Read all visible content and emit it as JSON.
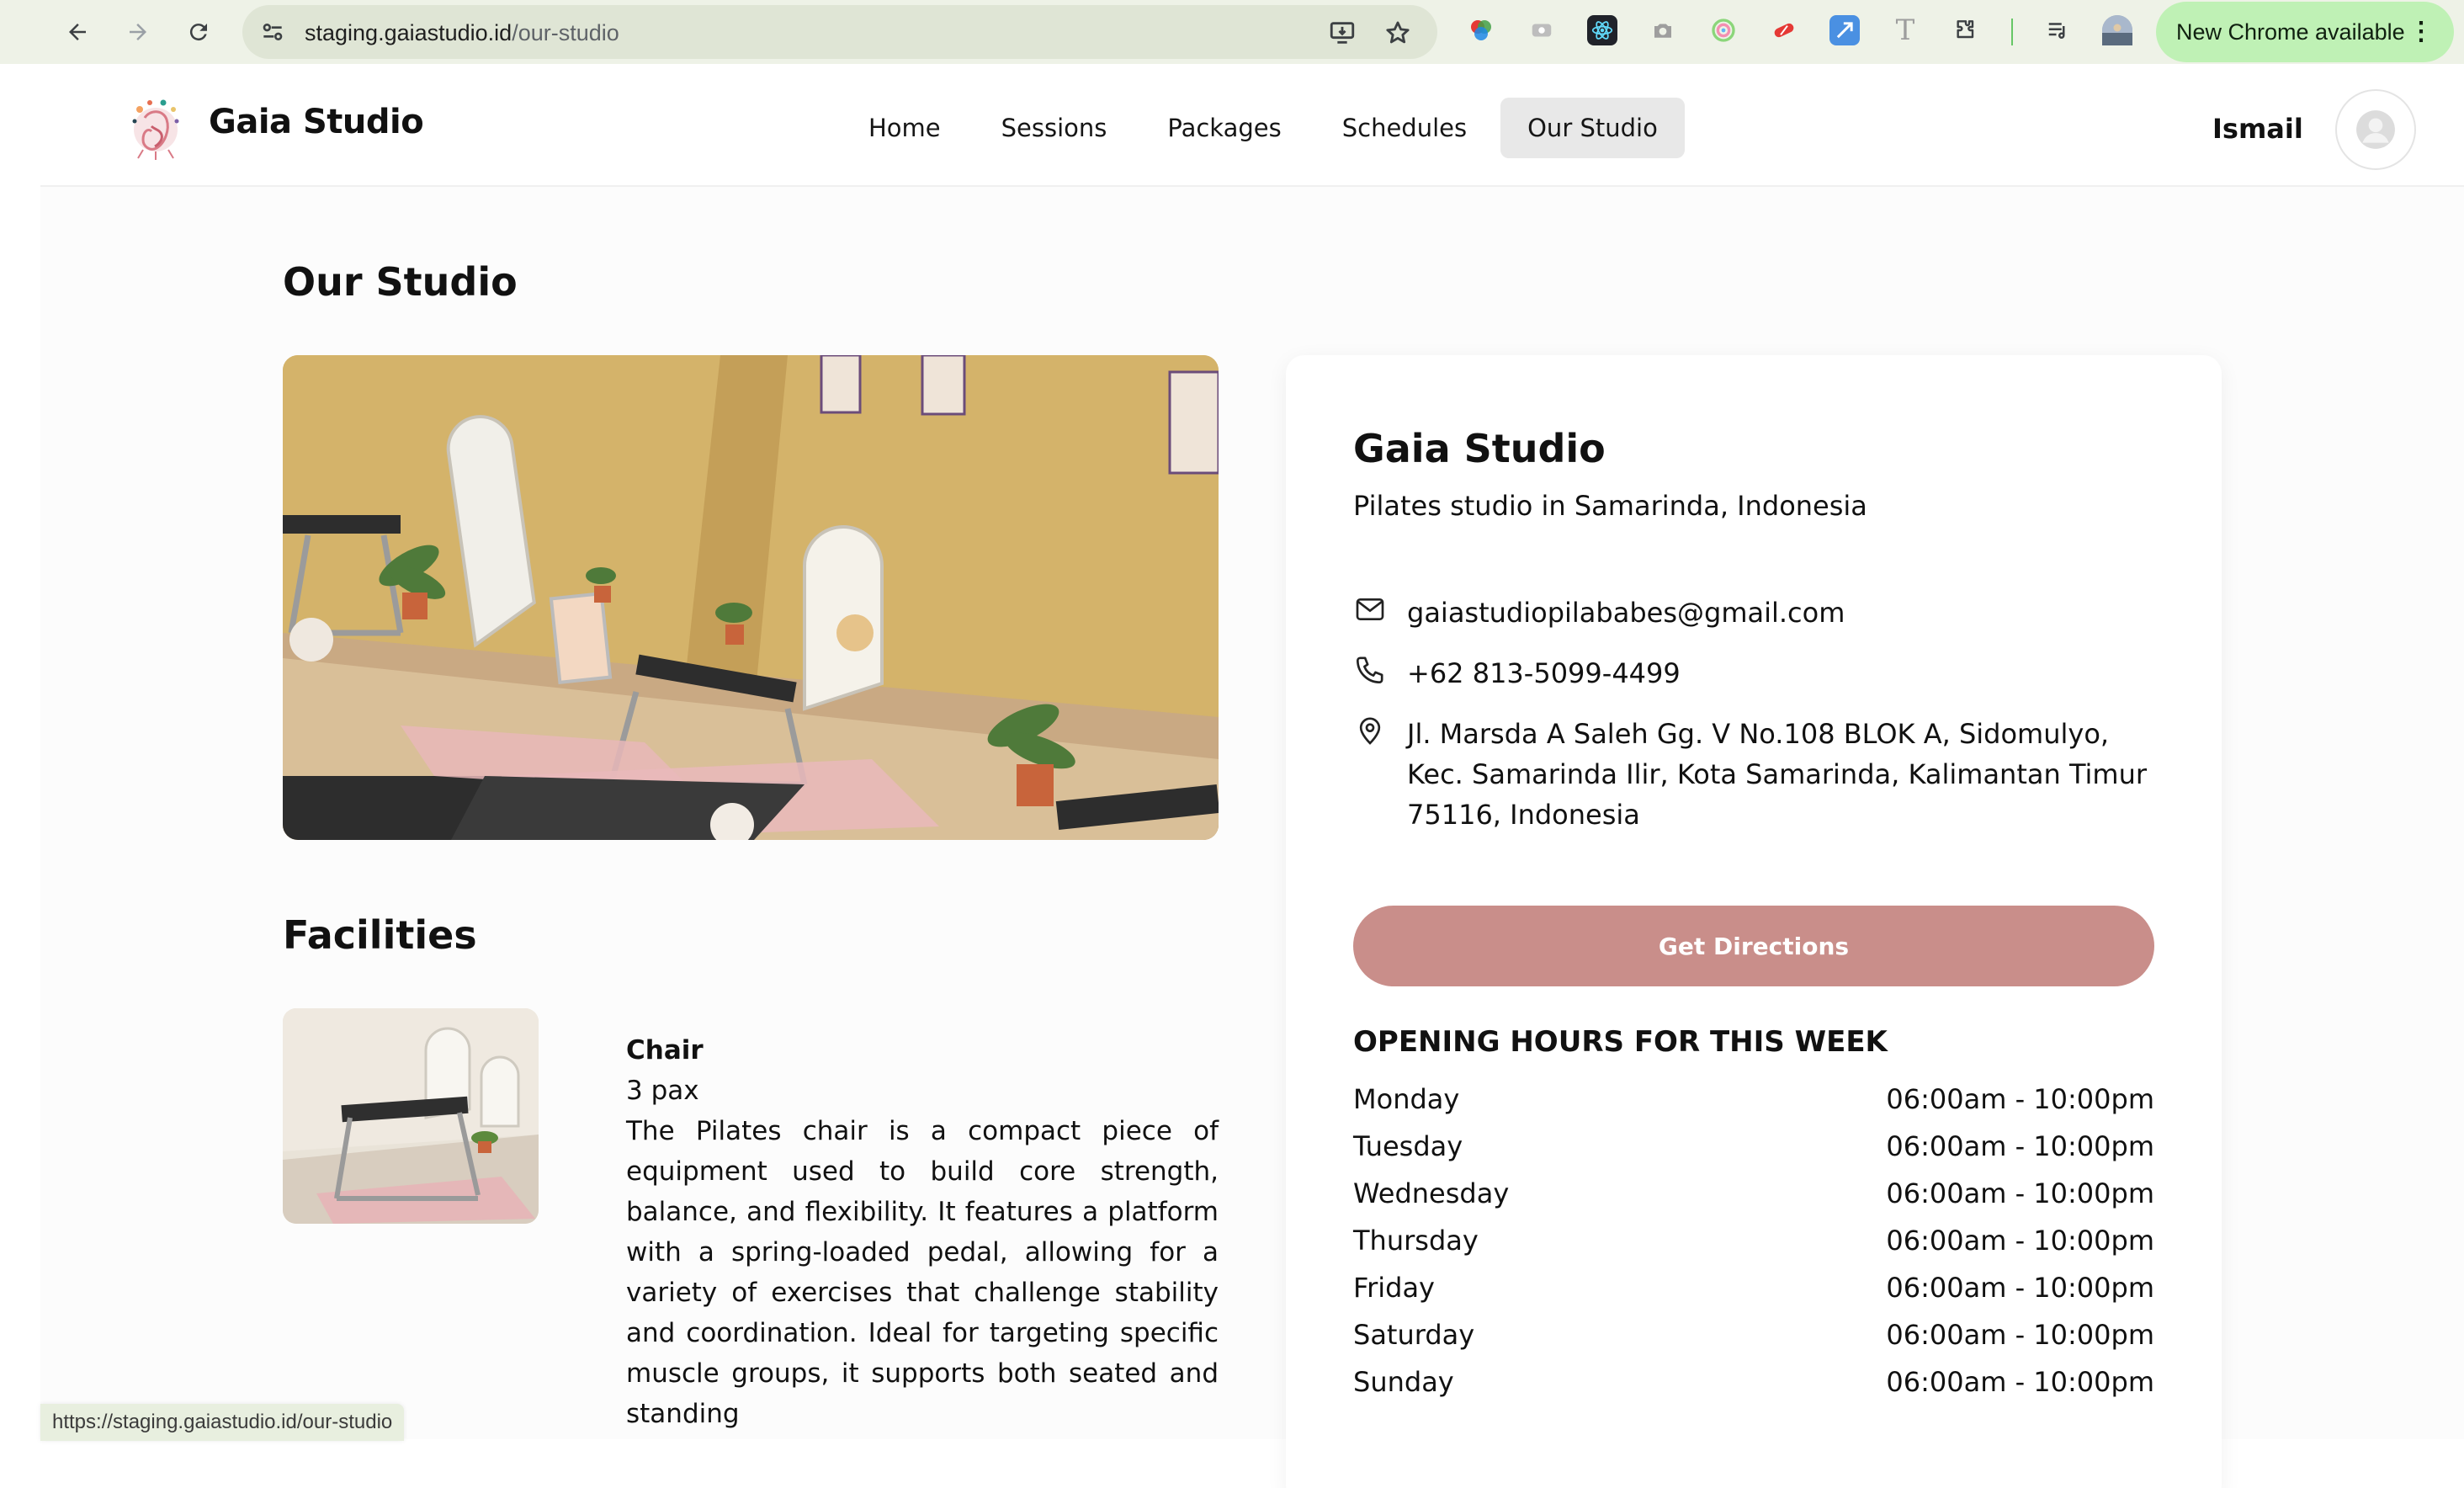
{
  "browser": {
    "url_host": "staging.gaiastudio.id",
    "url_path": "/our-studio",
    "update_label": "New Chrome available",
    "status_url": "https://staging.gaiastudio.id/our-studio"
  },
  "header": {
    "brand": "Gaia Studio",
    "nav": [
      {
        "label": "Home"
      },
      {
        "label": "Sessions"
      },
      {
        "label": "Packages"
      },
      {
        "label": "Schedules"
      },
      {
        "label": "Our Studio"
      }
    ],
    "user_name": "Ismail"
  },
  "main": {
    "page_title": "Our Studio",
    "facilities_title": "Facilities",
    "facility": {
      "name": "Chair",
      "capacity": "3 pax",
      "description": "The Pilates chair is a compact piece of equipment used to build core strength, balance, and flexibility. It features a platform with a spring-loaded pedal, allowing for a variety of exercises that challenge stability and coordination. Ideal for targeting specific muscle groups, it supports both seated and standing"
    }
  },
  "card": {
    "title": "Gaia Studio",
    "subtitle": "Pilates studio in Samarinda, Indonesia",
    "email": "gaiastudiopilababes@gmail.com",
    "phone": "+62 813-5099-4499",
    "address": "Jl. Marsda A Saleh Gg. V No.108 BLOK A, Sidomulyo, Kec. Samarinda Ilir, Kota Samarinda, Kalimantan Timur 75116, Indonesia",
    "directions_label": "Get Directions",
    "hours_title": "OPENING HOURS FOR THIS WEEK",
    "hours": [
      {
        "day": "Monday",
        "time": "06:00am - 10:00pm"
      },
      {
        "day": "Tuesday",
        "time": "06:00am - 10:00pm"
      },
      {
        "day": "Wednesday",
        "time": "06:00am - 10:00pm"
      },
      {
        "day": "Thursday",
        "time": "06:00am - 10:00pm"
      },
      {
        "day": "Friday",
        "time": "06:00am - 10:00pm"
      },
      {
        "day": "Saturday",
        "time": "06:00am - 10:00pm"
      },
      {
        "day": "Sunday",
        "time": "06:00am - 10:00pm"
      }
    ]
  },
  "colors": {
    "accent_button": "#c98e8a",
    "active_nav_bg": "#e8e8e8",
    "chrome_update_pill": "#bff1b5"
  }
}
